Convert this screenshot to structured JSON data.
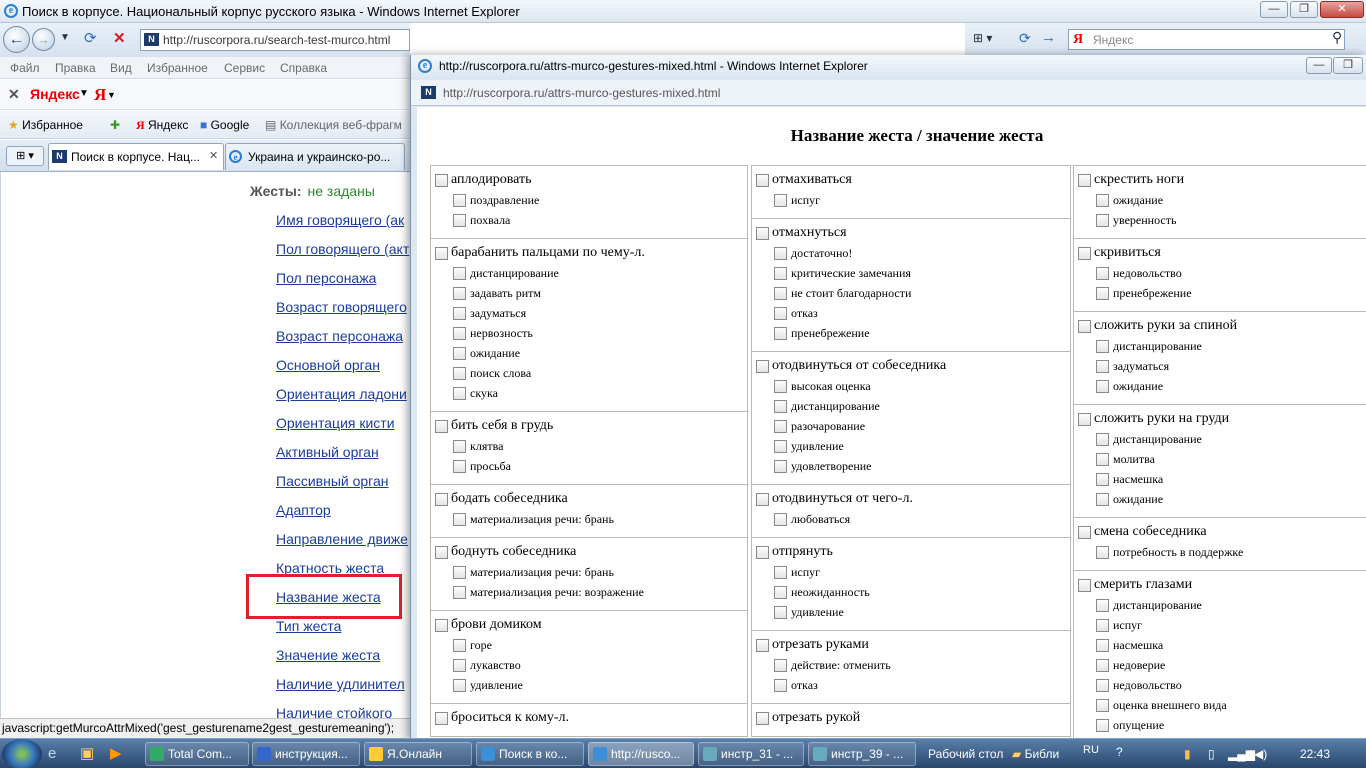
{
  "main_window": {
    "title": "Поиск в корпусе. Национальный корпус русского языка - Windows Internet Explorer",
    "address": "http://ruscorpora.ru/search-test-murco.html",
    "search_placeholder": "Яндекс",
    "menu": [
      "Файл",
      "Правка",
      "Вид",
      "Избранное",
      "Сервис",
      "Справка"
    ],
    "yandex_bar": {
      "logo": "Яндекс",
      "ya": "Я"
    },
    "favorites": {
      "label": "Избранное",
      "items": [
        "Яндекс",
        "Google",
        "Коллекция веб-фрагм"
      ]
    },
    "tabs": [
      "Поиск в корпусе. Нац...",
      "Украина и украинско-ро..."
    ],
    "content": {
      "gestures_label": "Жесты:",
      "gestures_value": "не заданы",
      "links": [
        "Имя говорящего (ак",
        "Пол говорящего (акт",
        "Пол персонажа",
        "Возраст говорящего",
        "Возраст персонажа",
        "Основной орган",
        "Ориентация ладони",
        "Ориентация кисти",
        "Активный орган",
        "Пассивный орган",
        "Адаптор",
        "Направление движе",
        "Кратность жеста",
        "Название жеста",
        "Тип жеста",
        "Значение жеста",
        "Наличие удлинител",
        "Наличие стойкого"
      ],
      "highlighted_link": "Название жеста"
    },
    "status": "javascript:getMurcoAttrMixed('gest_gesturename2gest_gesturemeaning');"
  },
  "popup": {
    "title": "http://ruscorpora.ru/attrs-murco-gestures-mixed.html - Windows Internet Explorer",
    "address": "http://ruscorpora.ru/attrs-murco-gestures-mixed.html",
    "heading": "Название жеста / значение жеста",
    "columns": [
      [
        {
          "name": "аплодировать",
          "meanings": [
            "поздравление",
            "похвала"
          ]
        },
        {
          "name": "барабанить пальцами по чему-л.",
          "meanings": [
            "дистанцирование",
            "задавать ритм",
            "задуматься",
            "нервозность",
            "ожидание",
            "поиск слова",
            "скука"
          ]
        },
        {
          "name": "бить себя в грудь",
          "meanings": [
            "клятва",
            "просьба"
          ]
        },
        {
          "name": "бодать собеседника",
          "meanings": [
            "материализация речи: брань"
          ]
        },
        {
          "name": "боднуть собеседника",
          "meanings": [
            "материализация речи: брань",
            "материализация речи: возражение"
          ]
        },
        {
          "name": "брови домиком",
          "meanings": [
            "горе",
            "лукавство",
            "удивление"
          ]
        },
        {
          "name": "броситься к кому-л.",
          "meanings": []
        }
      ],
      [
        {
          "name": "отмахиваться",
          "meanings": [
            "испуг"
          ]
        },
        {
          "name": "отмахнуться",
          "meanings": [
            "достаточно!",
            "критические замечания",
            "не стоит благодарности",
            "отказ",
            "пренебрежение"
          ]
        },
        {
          "name": "отодвинуться от собеседника",
          "meanings": [
            "высокая оценка",
            "дистанцирование",
            "разочарование",
            "удивление",
            "удовлетворение"
          ]
        },
        {
          "name": "отодвинуться от чего-л.",
          "meanings": [
            "любоваться"
          ]
        },
        {
          "name": "отпрянуть",
          "meanings": [
            "испуг",
            "неожиданность",
            "удивление"
          ]
        },
        {
          "name": "отрезать руками",
          "meanings": [
            "действие: отменить",
            "отказ"
          ]
        },
        {
          "name": "отрезать рукой",
          "meanings": []
        }
      ],
      [
        {
          "name": "скрестить ноги",
          "meanings": [
            "ожидание",
            "уверенность"
          ]
        },
        {
          "name": "скривиться",
          "meanings": [
            "недовольство",
            "пренебрежение"
          ]
        },
        {
          "name": "сложить руки за спиной",
          "meanings": [
            "дистанцирование",
            "задуматься",
            "ожидание"
          ]
        },
        {
          "name": "сложить руки на груди",
          "meanings": [
            "дистанцирование",
            "молитва",
            "насмешка",
            "ожидание"
          ]
        },
        {
          "name": "смена собеседника",
          "meanings": [
            "потребность в поддержке"
          ]
        },
        {
          "name": "смерить глазами",
          "meanings": [
            "дистанцирование",
            "испуг",
            "насмешка",
            "недоверие",
            "недовольство",
            "оценка внешнего вида",
            "опущение"
          ]
        }
      ]
    ]
  },
  "taskbar": {
    "items": [
      "Total Com...",
      "инструкция...",
      "Я.Онлайн",
      "Поиск в ко...",
      "http://rusco...",
      "инстр_31 - ...",
      "инстр_39 - ..."
    ],
    "desktop": "Рабочий стол",
    "library": "Библи",
    "lang": "RU",
    "time": "22:43"
  },
  "colors": {
    "link": "#1b3d99",
    "highlight": "#e0202a",
    "green": "#2a8a2a"
  }
}
